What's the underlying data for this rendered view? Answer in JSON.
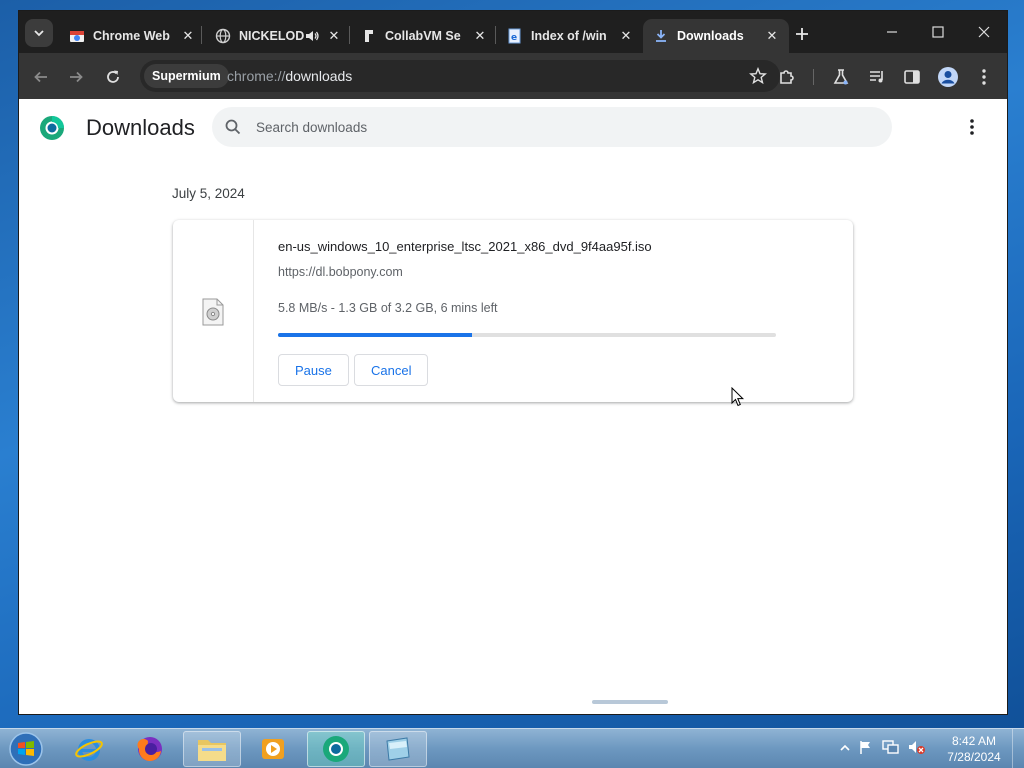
{
  "browser": {
    "tabs": [
      {
        "title": "Chrome Web",
        "icon": "chrome-web-store-icon",
        "active": false,
        "audio": false
      },
      {
        "title": "NICKELOD",
        "icon": "globe-icon",
        "active": false,
        "audio": true
      },
      {
        "title": "CollabVM Se",
        "icon": "collabvm-icon",
        "active": false,
        "audio": false
      },
      {
        "title": "Index of /win",
        "icon": "ie-page-icon",
        "active": false,
        "audio": false
      },
      {
        "title": "Downloads",
        "icon": "download-icon",
        "active": true,
        "audio": false
      }
    ],
    "profile_chip": "Supermium",
    "url_scheme": "chrome://",
    "url_host": "downloads"
  },
  "downloads_page": {
    "title": "Downloads",
    "search_placeholder": "Search downloads",
    "date_header": "July 5, 2024",
    "items": [
      {
        "filename": "en-us_windows_10_enterprise_ltsc_2021_x86_dvd_9f4aa95f.iso",
        "source_url": "https://dl.bobpony.com",
        "status": "5.8 MB/s - 1.3 GB of 3.2 GB, 6 mins left",
        "progress_fraction": 0.39,
        "pause_label": "Pause",
        "cancel_label": "Cancel"
      }
    ]
  },
  "taskbar": {
    "time": "8:42 AM",
    "date": "7/28/2024"
  },
  "colors": {
    "accent": "#1a73e8",
    "tabstrip": "#1f1f1f",
    "toolbar": "#353535"
  }
}
